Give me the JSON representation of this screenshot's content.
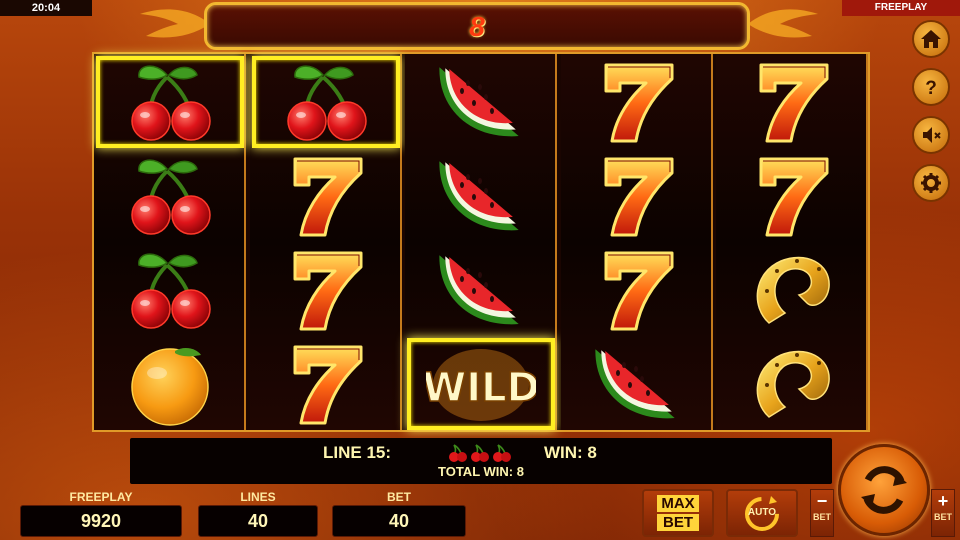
{
  "status_bar": {
    "time": "20:04",
    "mode": "FREEPLAY"
  },
  "win_display": {
    "value": "8"
  },
  "reels": [
    [
      "cherry",
      "cherry",
      "cherry",
      "orange"
    ],
    [
      "cherry",
      "seven",
      "seven",
      "seven"
    ],
    [
      "watermelon",
      "watermelon",
      "watermelon",
      "wild"
    ],
    [
      "seven",
      "seven",
      "seven",
      "watermelon"
    ],
    [
      "seven",
      "seven",
      "horseshoe",
      "horseshoe"
    ]
  ],
  "highlighted": [
    [
      0,
      0
    ],
    [
      1,
      0
    ],
    [
      2,
      3
    ]
  ],
  "wild_label": "WILD",
  "line_info": {
    "line_label": "LINE 15:",
    "win_label": "WIN: 8",
    "total_label": "TOTAL WIN: 8"
  },
  "bottom": {
    "freeplay_label": "FREEPLAY",
    "freeplay_value": "9920",
    "lines_label": "LINES",
    "lines_value": "40",
    "bet_label": "BET",
    "bet_value": "40"
  },
  "buttons": {
    "max_top": "MAX",
    "max_bottom": "BET",
    "auto": "AUTO",
    "minus": "−",
    "plus": "+",
    "minus_label": "BET",
    "plus_label": "BET"
  },
  "side_icons": [
    "home-icon",
    "help-icon",
    "sound-muted-icon",
    "gear-icon"
  ],
  "colors": {
    "highlight": "#ffee22",
    "frame": "#e09a28",
    "win_text": "#ff3a10"
  }
}
